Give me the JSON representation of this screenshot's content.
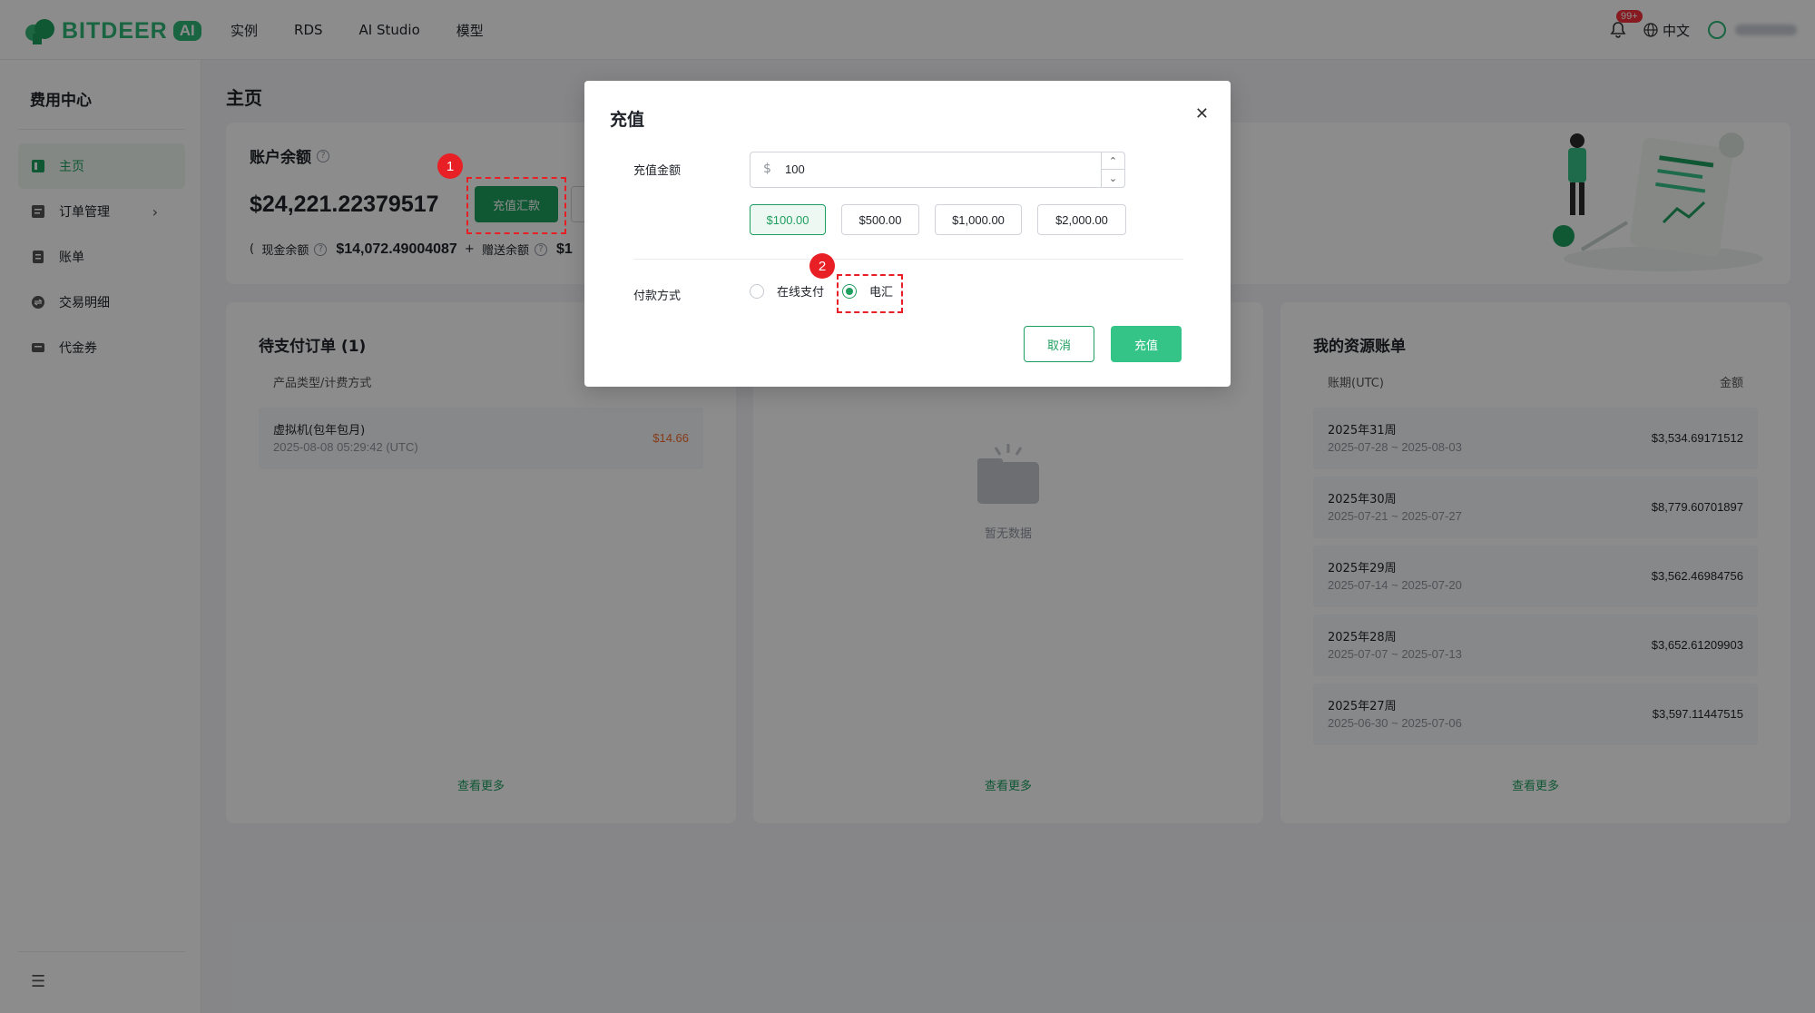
{
  "brand": {
    "name": "BITDEER",
    "badge": "AI"
  },
  "topnav": {
    "links": [
      "实例",
      "RDS",
      "AI Studio",
      "模型"
    ],
    "notif_badge": "99+",
    "language": "中文"
  },
  "sidebar": {
    "title": "费用中心",
    "items": [
      {
        "label": "主页",
        "icon": "home-icon",
        "active": true
      },
      {
        "label": "订单管理",
        "icon": "order-icon"
      },
      {
        "label": "账单",
        "icon": "bill-icon"
      },
      {
        "label": "交易明细",
        "icon": "transaction-icon"
      },
      {
        "label": "代金券",
        "icon": "voucher-icon"
      }
    ]
  },
  "page": {
    "title": "主页"
  },
  "balance": {
    "label": "账户余额",
    "amount": "$24,221.22379517",
    "recharge_button": "充值汇款",
    "paren": "(",
    "cash_label": "现金余额",
    "cash_value": "$14,072.49004087",
    "plus": "+",
    "gift_label": "赠送余额",
    "gift_value_partial": "$1"
  },
  "pending_orders": {
    "title": "待支付订单 (1)",
    "col_type": "产品类型/计费方式",
    "rows": [
      {
        "name": "虚拟机(包年包月)",
        "time": "2025-08-08 05:29:42 (UTC)",
        "amount": "$14.66"
      }
    ],
    "see_more": "查看更多"
  },
  "middle_card": {
    "empty_text": "暂无数据",
    "see_more": "查看更多"
  },
  "resource_bills": {
    "title": "我的资源账单",
    "col_period": "账期(UTC)",
    "col_amount": "金额",
    "rows": [
      {
        "week": "2025年31周",
        "range": "2025-07-28 ~ 2025-08-03",
        "amount": "$3,534.69171512"
      },
      {
        "week": "2025年30周",
        "range": "2025-07-21 ~ 2025-07-27",
        "amount": "$8,779.60701897"
      },
      {
        "week": "2025年29周",
        "range": "2025-07-14 ~ 2025-07-20",
        "amount": "$3,562.46984756"
      },
      {
        "week": "2025年28周",
        "range": "2025-07-07 ~ 2025-07-13",
        "amount": "$3,652.61209903"
      },
      {
        "week": "2025年27周",
        "range": "2025-06-30 ~ 2025-07-06",
        "amount": "$3,597.11447515"
      }
    ],
    "see_more": "查看更多"
  },
  "modal": {
    "title": "充值",
    "amount_label": "充值金额",
    "currency": "$",
    "amount_value": "100",
    "presets": [
      "$100.00",
      "$500.00",
      "$1,000.00",
      "$2,000.00"
    ],
    "selected_preset": "$100.00",
    "payment_label": "付款方式",
    "payment_options": [
      "在线支付",
      "电汇"
    ],
    "selected_payment": "电汇",
    "cancel": "取消",
    "confirm": "充值"
  },
  "annotations": [
    "1",
    "2"
  ],
  "colors": {
    "brand_green": "#1e9e5f",
    "accent_green": "#35c488",
    "annotation_red": "#e81f24",
    "warning_orange": "#f56c2d"
  }
}
